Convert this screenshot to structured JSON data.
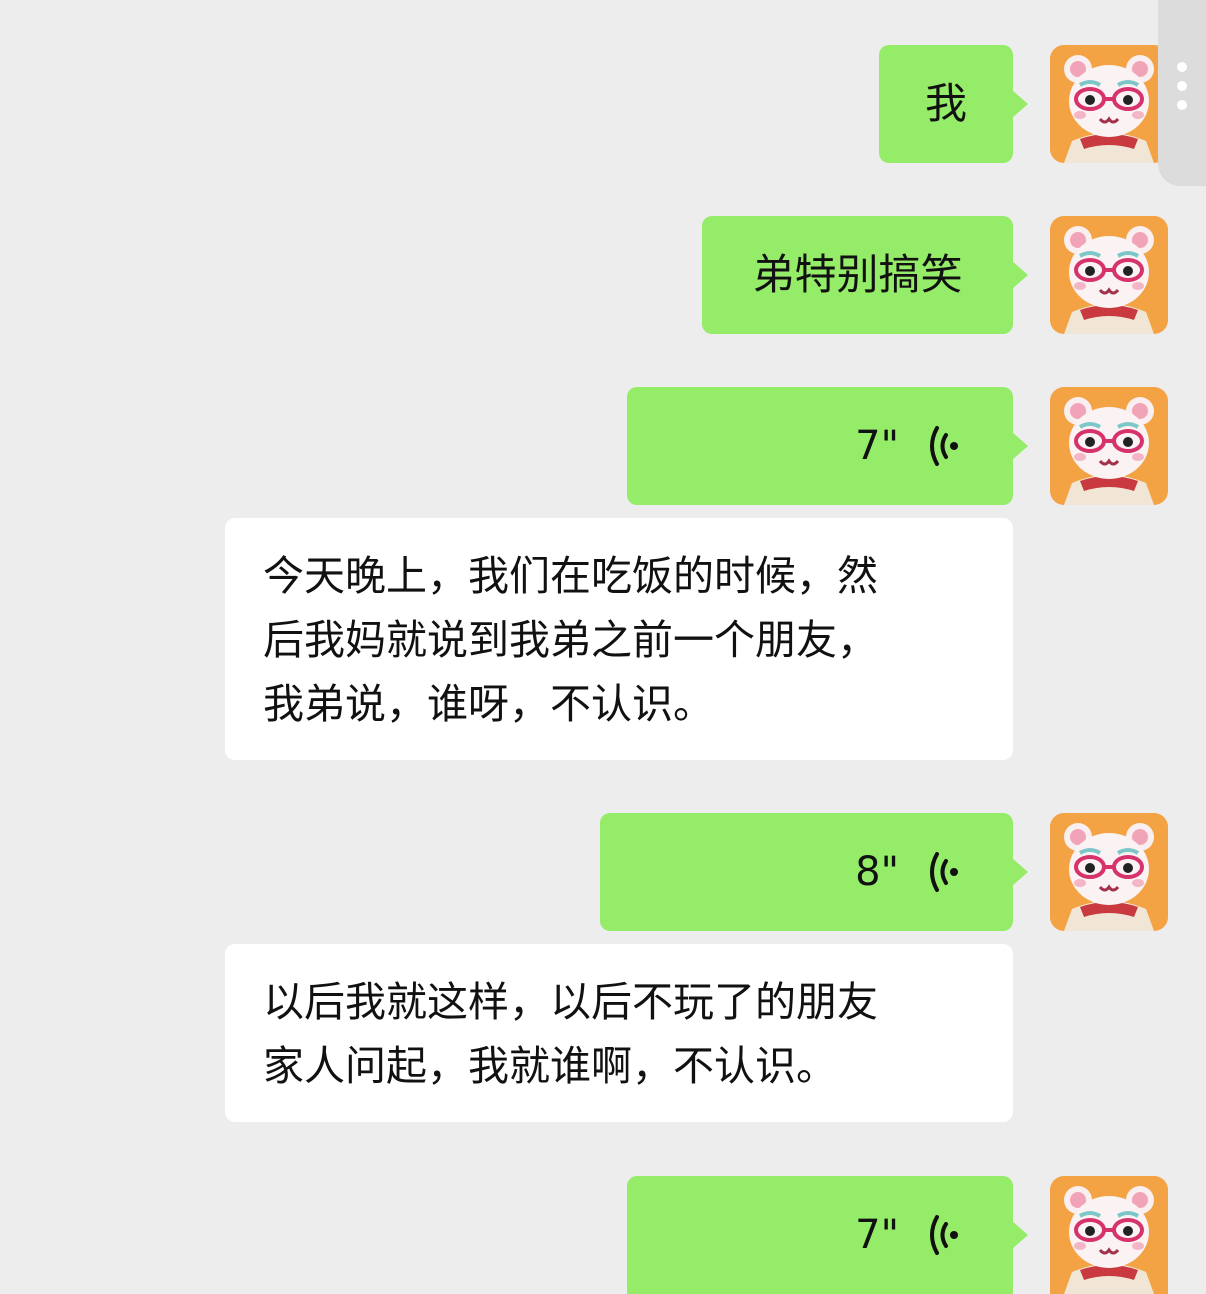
{
  "messages": [
    {
      "type": "text",
      "side": "right",
      "text": "我"
    },
    {
      "type": "text",
      "side": "right",
      "text": "弟特别搞笑"
    },
    {
      "type": "voice",
      "side": "right",
      "duration": "7\""
    },
    {
      "type": "text",
      "side": "left",
      "lines": [
        "今天晚上，我们在吃饭的时候，然",
        "后我妈就说到我弟之前一个朋友，",
        "我弟说，谁呀，不认识。"
      ]
    },
    {
      "type": "voice",
      "side": "right",
      "duration": "8\""
    },
    {
      "type": "text",
      "side": "left",
      "lines": [
        "以后我就这样，以后不玩了的朋友",
        "家人问起，我就谁啊，不认识。"
      ]
    },
    {
      "type": "voice",
      "side": "right",
      "duration": "7\""
    }
  ],
  "colors": {
    "background": "#ededed",
    "sent_bubble": "#95ec69",
    "received_bubble": "#ffffff",
    "avatar_bg": "#f29a3a"
  },
  "icons": {
    "voice": "voice-wave-icon",
    "avatar": "pink-bear-avatar",
    "scroll": "more-dots-icon"
  }
}
